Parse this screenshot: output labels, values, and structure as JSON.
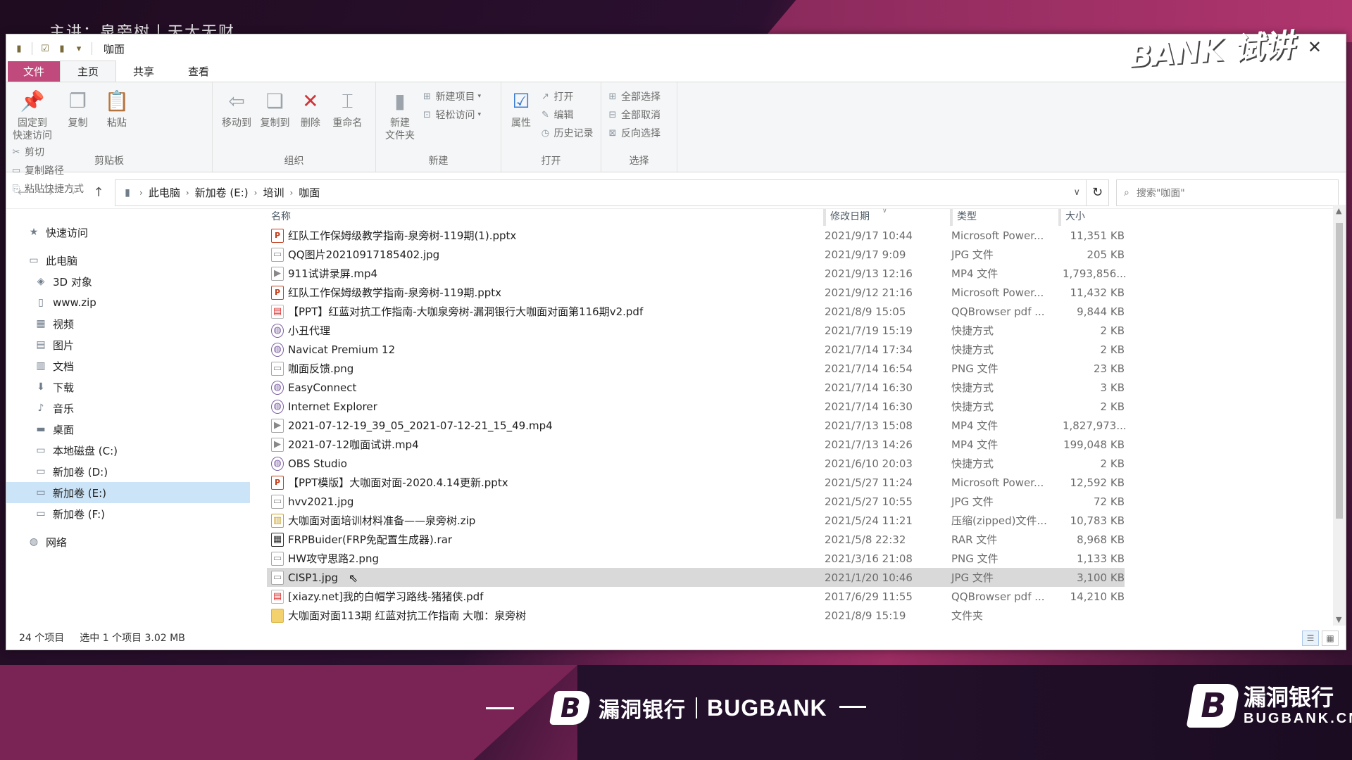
{
  "overlay": {
    "speaker": "主讲：泉旁树丨天大无财",
    "corner_logo": "BANK 试讲",
    "brand_cn": "漏洞银行",
    "brand_en": "BUGBANK",
    "brand_right_cn": "漏洞银行",
    "brand_right_en": "BUGBANK.CN",
    "brand_mark": "B"
  },
  "window": {
    "title": "咖面",
    "close": "✕"
  },
  "ribbon_tabs": [
    "文件",
    "主页",
    "共享",
    "查看"
  ],
  "ribbon": {
    "clipboard": {
      "label": "剪贴板",
      "pin": "固定到\n快速访问",
      "copy": "复制",
      "paste": "粘贴",
      "cut": "剪切",
      "copy_path": "复制路径",
      "paste_shortcut": "粘贴快捷方式"
    },
    "organize": {
      "label": "组织",
      "move_to": "移动到",
      "copy_to": "复制到",
      "delete": "删除",
      "rename": "重命名"
    },
    "new": {
      "label": "新建",
      "new_folder": "新建\n文件夹",
      "new_item": "新建项目",
      "easy_access": "轻松访问"
    },
    "open": {
      "label": "打开",
      "properties": "属性",
      "open": "打开",
      "edit": "编辑",
      "history": "历史记录"
    },
    "select": {
      "label": "选择",
      "select_all": "全部选择",
      "select_none": "全部取消",
      "invert": "反向选择"
    }
  },
  "address": {
    "crumbs": [
      "此电脑",
      "新加卷 (E:)",
      "培训",
      "咖面"
    ],
    "search_placeholder": "搜索\"咖面\""
  },
  "nav": [
    {
      "label": "快速访问",
      "level": "l1",
      "icon": "star-icon",
      "glyph": "★"
    },
    {
      "label": "此电脑",
      "level": "l1",
      "icon": "computer-icon",
      "glyph": "▭"
    },
    {
      "label": "3D 对象",
      "level": "l2",
      "icon": "cube-icon",
      "glyph": "◈"
    },
    {
      "label": "www.zip",
      "level": "l2",
      "icon": "zip-icon",
      "glyph": "▯"
    },
    {
      "label": "视频",
      "level": "l2",
      "icon": "video-icon",
      "glyph": "▦"
    },
    {
      "label": "图片",
      "level": "l2",
      "icon": "picture-icon",
      "glyph": "▤"
    },
    {
      "label": "文档",
      "level": "l2",
      "icon": "document-icon",
      "glyph": "▥"
    },
    {
      "label": "下载",
      "level": "l2",
      "icon": "download-icon",
      "glyph": "⬇"
    },
    {
      "label": "音乐",
      "level": "l2",
      "icon": "music-icon",
      "glyph": "♪"
    },
    {
      "label": "桌面",
      "level": "l2",
      "icon": "desktop-icon",
      "glyph": "▬"
    },
    {
      "label": "本地磁盘 (C:)",
      "level": "l2",
      "icon": "drive-icon",
      "glyph": "▭"
    },
    {
      "label": "新加卷 (D:)",
      "level": "l2",
      "icon": "drive-icon",
      "glyph": "▭"
    },
    {
      "label": "新加卷 (E:)",
      "level": "l2",
      "icon": "drive-icon",
      "glyph": "▭",
      "selected": true
    },
    {
      "label": "新加卷 (F:)",
      "level": "l2",
      "icon": "drive-icon",
      "glyph": "▭"
    },
    {
      "label": "网络",
      "level": "l1",
      "icon": "network-icon",
      "glyph": "◍"
    }
  ],
  "columns": {
    "name": "名称",
    "date": "修改日期",
    "type": "类型",
    "size": "大小"
  },
  "files": [
    {
      "name": "红队工作保姆级教学指南-泉旁树-119期(1).pptx",
      "date": "2021/9/17 10:44",
      "type": "Microsoft Power...",
      "size": "11,351 KB",
      "kind": "ppt"
    },
    {
      "name": "QQ图片20210917185402.jpg",
      "date": "2021/9/17 9:09",
      "type": "JPG 文件",
      "size": "205 KB",
      "kind": "img"
    },
    {
      "name": "911试讲录屏.mp4",
      "date": "2021/9/13 12:16",
      "type": "MP4 文件",
      "size": "1,793,856...",
      "kind": "vid"
    },
    {
      "name": "红队工作保姆级教学指南-泉旁树-119期.pptx",
      "date": "2021/9/12 21:16",
      "type": "Microsoft Power...",
      "size": "11,432 KB",
      "kind": "ppt"
    },
    {
      "name": "【PPT】红蓝对抗工作指南-大咖泉旁树-漏洞银行大咖面对面第116期v2.pdf",
      "date": "2021/8/9 15:05",
      "type": "QQBrowser pdf ...",
      "size": "9,844 KB",
      "kind": "pdf"
    },
    {
      "name": "小丑代理",
      "date": "2021/7/19 15:19",
      "type": "快捷方式",
      "size": "2 KB",
      "kind": "lnk"
    },
    {
      "name": "Navicat Premium 12",
      "date": "2021/7/14 17:34",
      "type": "快捷方式",
      "size": "2 KB",
      "kind": "lnk"
    },
    {
      "name": "咖面反馈.png",
      "date": "2021/7/14 16:54",
      "type": "PNG 文件",
      "size": "23 KB",
      "kind": "img"
    },
    {
      "name": "EasyConnect",
      "date": "2021/7/14 16:30",
      "type": "快捷方式",
      "size": "3 KB",
      "kind": "lnk"
    },
    {
      "name": "Internet Explorer",
      "date": "2021/7/14 16:30",
      "type": "快捷方式",
      "size": "2 KB",
      "kind": "lnk"
    },
    {
      "name": "2021-07-12-19_39_05_2021-07-12-21_15_49.mp4",
      "date": "2021/7/13 15:08",
      "type": "MP4 文件",
      "size": "1,827,973...",
      "kind": "vid"
    },
    {
      "name": "2021-07-12咖面试讲.mp4",
      "date": "2021/7/13 14:26",
      "type": "MP4 文件",
      "size": "199,048 KB",
      "kind": "vid"
    },
    {
      "name": "OBS Studio",
      "date": "2021/6/10 20:03",
      "type": "快捷方式",
      "size": "2 KB",
      "kind": "lnk"
    },
    {
      "name": "【PPT模版】大咖面对面-2020.4.14更新.pptx",
      "date": "2021/5/27 11:24",
      "type": "Microsoft Power...",
      "size": "12,592 KB",
      "kind": "ppt"
    },
    {
      "name": "hvv2021.jpg",
      "date": "2021/5/27 10:55",
      "type": "JPG 文件",
      "size": "72 KB",
      "kind": "img"
    },
    {
      "name": "大咖面对面培训材料准备——泉旁树.zip",
      "date": "2021/5/24 11:21",
      "type": "压缩(zipped)文件...",
      "size": "10,783 KB",
      "kind": "zip"
    },
    {
      "name": "FRPBuider(FRP免配置生成器).rar",
      "date": "2021/5/8 22:32",
      "type": "RAR 文件",
      "size": "8,968 KB",
      "kind": "rar"
    },
    {
      "name": "HW攻守思路2.png",
      "date": "2021/3/16 21:08",
      "type": "PNG 文件",
      "size": "1,133 KB",
      "kind": "img"
    },
    {
      "name": "CISP1.jpg",
      "date": "2021/1/20 10:46",
      "type": "JPG 文件",
      "size": "3,100 KB",
      "kind": "img",
      "selected": true
    },
    {
      "name": "[xiazy.net]我的白帽学习路线-猪猪侠.pdf",
      "date": "2017/6/29 11:55",
      "type": "QQBrowser pdf ...",
      "size": "14,210 KB",
      "kind": "pdf"
    },
    {
      "name": "大咖面对面113期 红蓝对抗工作指南 大咖：泉旁树",
      "date": "2021/8/9 15:19",
      "type": "文件夹",
      "size": "",
      "kind": "folder"
    }
  ],
  "status": {
    "count": "24 个项目",
    "selection": "选中 1 个项目  3.02 MB"
  }
}
